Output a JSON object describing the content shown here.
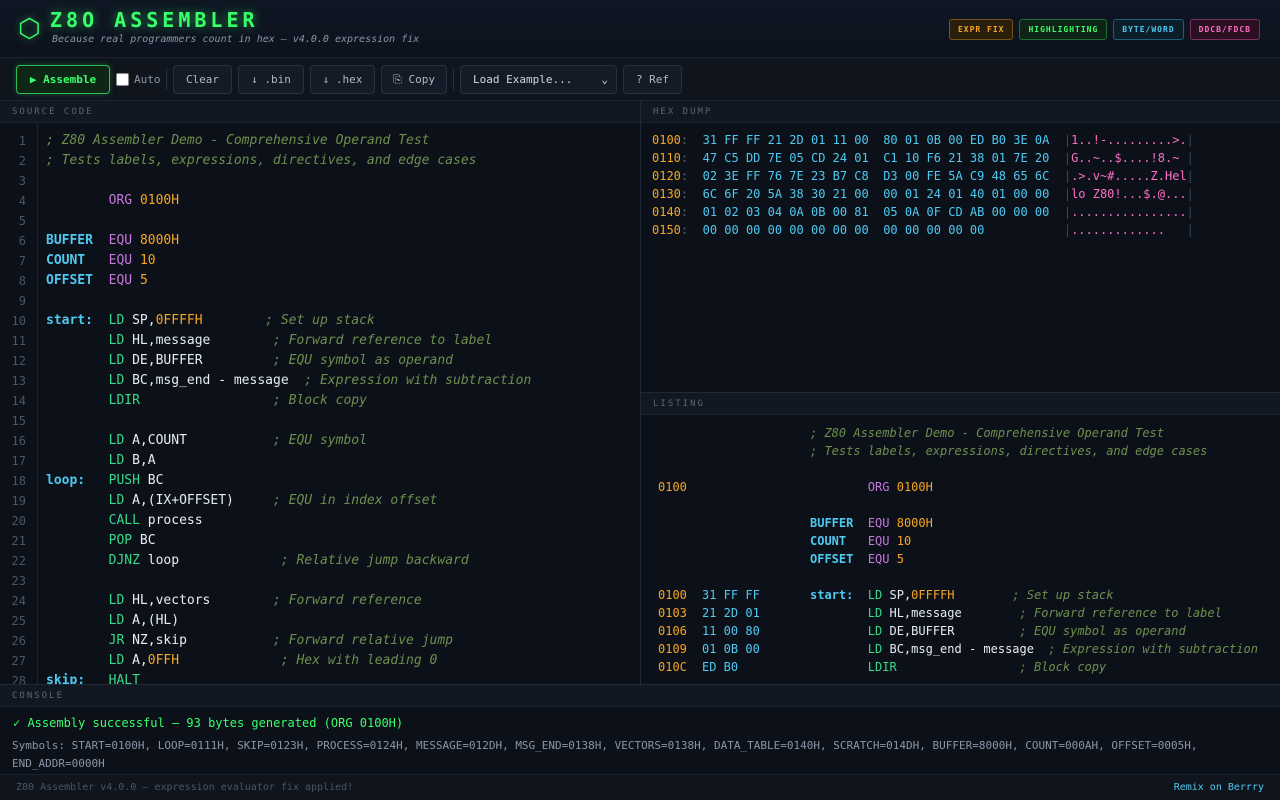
{
  "header": {
    "logo_glyph": "⬡",
    "title": "Z8O ASSEMBLER",
    "subtitle": "Because real programmers count in hex — v4.0.0 expression fix",
    "badges": [
      "EXPR FIX",
      "HIGHLIGHTING",
      "BYTE/WORD",
      "DDCB/FDCB"
    ]
  },
  "toolbar": {
    "assemble": "▶ Assemble",
    "auto": "Auto",
    "auto_checked": false,
    "clear": "Clear",
    "bin": "↓ .bin",
    "hex": "↓ .hex",
    "copy": "⎘ Copy",
    "example_select": "Load Example...",
    "ref": "? Ref"
  },
  "panels": {
    "source": "SOURCE CODE",
    "hex": "HEX DUMP",
    "listing": "LISTING",
    "console": "CONSOLE"
  },
  "source_lines": [
    [
      [
        "; Z80 Assembler Demo - Comprehensive Operand Test",
        "comment"
      ]
    ],
    [
      [
        "; Tests labels, expressions, directives, and edge cases",
        "comment"
      ]
    ],
    [],
    [
      [
        "        ",
        ""
      ],
      [
        "ORG",
        "dir"
      ],
      [
        " ",
        ""
      ],
      [
        "0100H",
        "num"
      ]
    ],
    [],
    [
      [
        "BUFFER",
        "label"
      ],
      [
        "  ",
        ""
      ],
      [
        "EQU",
        "dir"
      ],
      [
        " ",
        ""
      ],
      [
        "8000H",
        "num"
      ]
    ],
    [
      [
        "COUNT",
        "label"
      ],
      [
        "   ",
        ""
      ],
      [
        "EQU",
        "dir"
      ],
      [
        " ",
        ""
      ],
      [
        "10",
        "num"
      ]
    ],
    [
      [
        "OFFSET",
        "label"
      ],
      [
        "  ",
        ""
      ],
      [
        "EQU",
        "dir"
      ],
      [
        " ",
        ""
      ],
      [
        "5",
        "num"
      ]
    ],
    [],
    [
      [
        "start:",
        "label"
      ],
      [
        "  ",
        ""
      ],
      [
        "LD",
        "instr"
      ],
      [
        " SP,",
        "op"
      ],
      [
        "0FFFFH",
        "num"
      ],
      [
        "        ",
        ""
      ],
      [
        "; Set up stack",
        "comment"
      ]
    ],
    [
      [
        "        ",
        ""
      ],
      [
        "LD",
        "instr"
      ],
      [
        " HL,message        ",
        "op"
      ],
      [
        "; Forward reference to label",
        "comment"
      ]
    ],
    [
      [
        "        ",
        ""
      ],
      [
        "LD",
        "instr"
      ],
      [
        " DE,BUFFER         ",
        "op"
      ],
      [
        "; EQU symbol as operand",
        "comment"
      ]
    ],
    [
      [
        "        ",
        ""
      ],
      [
        "LD",
        "instr"
      ],
      [
        " BC,msg_end - message  ",
        "op"
      ],
      [
        "; Expression with subtraction",
        "comment"
      ]
    ],
    [
      [
        "        ",
        ""
      ],
      [
        "LDIR",
        "instr"
      ],
      [
        "                 ",
        ""
      ],
      [
        "; Block copy",
        "comment"
      ]
    ],
    [],
    [
      [
        "        ",
        ""
      ],
      [
        "LD",
        "instr"
      ],
      [
        " A,COUNT           ",
        "op"
      ],
      [
        "; EQU symbol",
        "comment"
      ]
    ],
    [
      [
        "        ",
        ""
      ],
      [
        "LD",
        "instr"
      ],
      [
        " B,A",
        "op"
      ]
    ],
    [
      [
        "loop:",
        "label"
      ],
      [
        "   ",
        ""
      ],
      [
        "PUSH",
        "instr"
      ],
      [
        " BC",
        "op"
      ]
    ],
    [
      [
        "        ",
        ""
      ],
      [
        "LD",
        "instr"
      ],
      [
        " A,(IX+OFFSET)     ",
        "op"
      ],
      [
        "; EQU in index offset",
        "comment"
      ]
    ],
    [
      [
        "        ",
        ""
      ],
      [
        "CALL",
        "instr"
      ],
      [
        " process",
        "op"
      ]
    ],
    [
      [
        "        ",
        ""
      ],
      [
        "POP",
        "instr"
      ],
      [
        " BC",
        "op"
      ]
    ],
    [
      [
        "        ",
        ""
      ],
      [
        "DJNZ",
        "instr"
      ],
      [
        " loop             ",
        "op"
      ],
      [
        "; Relative jump backward",
        "comment"
      ]
    ],
    [],
    [
      [
        "        ",
        ""
      ],
      [
        "LD",
        "instr"
      ],
      [
        " HL,vectors        ",
        "op"
      ],
      [
        "; Forward reference",
        "comment"
      ]
    ],
    [
      [
        "        ",
        ""
      ],
      [
        "LD",
        "instr"
      ],
      [
        " A,(HL)",
        "op"
      ]
    ],
    [
      [
        "        ",
        ""
      ],
      [
        "JR",
        "instr"
      ],
      [
        " NZ,skip           ",
        "op"
      ],
      [
        "; Forward relative jump",
        "comment"
      ]
    ],
    [
      [
        "        ",
        ""
      ],
      [
        "LD",
        "instr"
      ],
      [
        " A,",
        "op"
      ],
      [
        "0FFH",
        "num"
      ],
      [
        "             ",
        ""
      ],
      [
        "; Hex with leading 0",
        "comment"
      ]
    ],
    [
      [
        "skip:",
        "label"
      ],
      [
        "   ",
        ""
      ],
      [
        "HALT",
        "instr"
      ]
    ]
  ],
  "hex_rows": [
    {
      "addr": "0100",
      "bytes": "31 FF FF 21 2D 01 11 00  80 01 0B 00 ED B0 3E 0A",
      "ascii": "1..!-.........>."
    },
    {
      "addr": "0110",
      "bytes": "47 C5 DD 7E 05 CD 24 01  C1 10 F6 21 38 01 7E 20",
      "ascii": "G..~..$....!8.~ "
    },
    {
      "addr": "0120",
      "bytes": "02 3E FF 76 7E 23 B7 C8  D3 00 FE 5A C9 48 65 6C",
      "ascii": ".>.v~#.....Z.Hel"
    },
    {
      "addr": "0130",
      "bytes": "6C 6F 20 5A 38 30 21 00  00 01 24 01 40 01 00 00",
      "ascii": "lo Z80!...$.@..."
    },
    {
      "addr": "0140",
      "bytes": "01 02 03 04 0A 0B 00 81  05 0A 0F CD AB 00 00 00",
      "ascii": "................"
    },
    {
      "addr": "0150",
      "bytes": "00 00 00 00 00 00 00 00  00 00 00 00 00         ",
      "ascii": ".............   "
    }
  ],
  "listing_rows": [
    {
      "addr": "",
      "bytes": "",
      "src": [
        [
          "; Z80 Assembler Demo - Comprehensive Operand Test",
          "comment"
        ]
      ]
    },
    {
      "addr": "",
      "bytes": "",
      "src": [
        [
          "; Tests labels, expressions, directives, and edge cases",
          "comment"
        ]
      ]
    },
    {
      "addr": "",
      "bytes": "",
      "src": []
    },
    {
      "addr": "0100",
      "bytes": "",
      "src": [
        [
          "        ",
          ""
        ],
        [
          "ORG",
          "dir"
        ],
        [
          " ",
          ""
        ],
        [
          "0100H",
          "num"
        ]
      ]
    },
    {
      "addr": "",
      "bytes": "",
      "src": []
    },
    {
      "addr": "",
      "bytes": "",
      "src": [
        [
          "BUFFER",
          "label"
        ],
        [
          "  ",
          ""
        ],
        [
          "EQU",
          "dir"
        ],
        [
          " ",
          ""
        ],
        [
          "8000H",
          "num"
        ]
      ]
    },
    {
      "addr": "",
      "bytes": "",
      "src": [
        [
          "COUNT",
          "label"
        ],
        [
          "   ",
          ""
        ],
        [
          "EQU",
          "dir"
        ],
        [
          " ",
          ""
        ],
        [
          "10",
          "num"
        ]
      ]
    },
    {
      "addr": "",
      "bytes": "",
      "src": [
        [
          "OFFSET",
          "label"
        ],
        [
          "  ",
          ""
        ],
        [
          "EQU",
          "dir"
        ],
        [
          " ",
          ""
        ],
        [
          "5",
          "num"
        ]
      ]
    },
    {
      "addr": "",
      "bytes": "",
      "src": []
    },
    {
      "addr": "0100",
      "bytes": "31 FF FF",
      "src": [
        [
          "start:",
          "label"
        ],
        [
          "  ",
          ""
        ],
        [
          "LD",
          "instr"
        ],
        [
          " SP,",
          "op"
        ],
        [
          "0FFFFH",
          "num"
        ],
        [
          "        ",
          ""
        ],
        [
          "; Set up stack",
          "comment"
        ]
      ]
    },
    {
      "addr": "0103",
      "bytes": "21 2D 01",
      "src": [
        [
          "        ",
          ""
        ],
        [
          "LD",
          "instr"
        ],
        [
          " HL,message        ",
          "op"
        ],
        [
          "; Forward reference to label",
          "comment"
        ]
      ]
    },
    {
      "addr": "0106",
      "bytes": "11 00 80",
      "src": [
        [
          "        ",
          ""
        ],
        [
          "LD",
          "instr"
        ],
        [
          " DE,BUFFER         ",
          "op"
        ],
        [
          "; EQU symbol as operand",
          "comment"
        ]
      ]
    },
    {
      "addr": "0109",
      "bytes": "01 0B 00",
      "src": [
        [
          "        ",
          ""
        ],
        [
          "LD",
          "instr"
        ],
        [
          " BC,msg_end - message  ",
          "op"
        ],
        [
          "; Expression with subtraction",
          "comment"
        ]
      ]
    },
    {
      "addr": "010C",
      "bytes": "ED B0",
      "src": [
        [
          "        ",
          ""
        ],
        [
          "LDIR",
          "instr"
        ],
        [
          "                 ",
          ""
        ],
        [
          "; Block copy",
          "comment"
        ]
      ]
    }
  ],
  "console": {
    "status": "✓ Assembly successful — 93 bytes generated (ORG 0100H)",
    "symbols": "Symbols: START=0100H, LOOP=0111H, SKIP=0123H, PROCESS=0124H, MESSAGE=012DH, MSG_END=0138H, VECTORS=0138H, DATA_TABLE=0140H, SCRATCH=014DH, BUFFER=8000H, COUNT=000AH, OFFSET=0005H, END_ADDR=0000H"
  },
  "footer": {
    "left": "Z80 Assembler v4.0.0 — expression evaluator fix applied!",
    "right": "Remix on Berrry"
  }
}
